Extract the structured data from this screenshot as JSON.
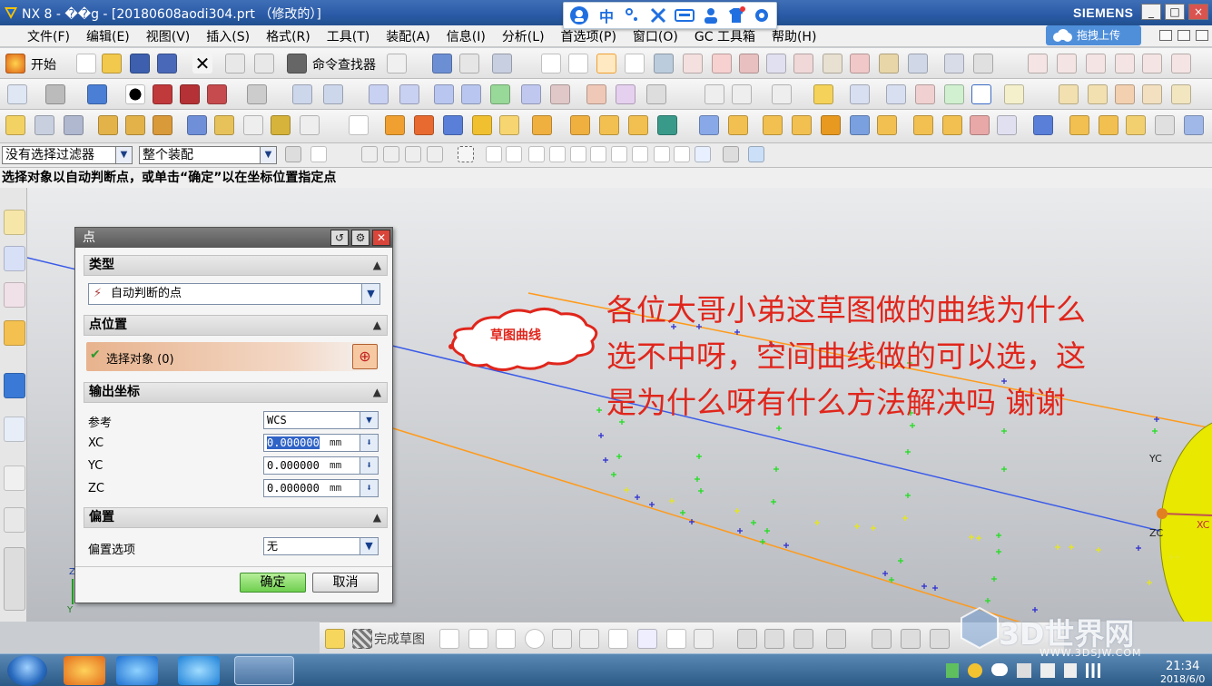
{
  "window": {
    "title": "NX 8 - ��g - [20180608aodi304.prt （修改的）]",
    "brand": "SIEMENS",
    "controls": [
      "_",
      "□",
      "×"
    ]
  },
  "ime_toolbar": {
    "icons": [
      "ime-logo-icon",
      "中",
      "°,",
      "tools-icon",
      "keyboard-icon",
      "user-icon",
      "skin-icon",
      "settings-icon"
    ],
    "chinese_label": "中"
  },
  "menu": {
    "items": [
      "文件(F)",
      "编辑(E)",
      "视图(V)",
      "插入(S)",
      "格式(R)",
      "工具(T)",
      "装配(A)",
      "信息(I)",
      "分析(L)",
      "首选项(P)",
      "窗口(O)",
      "GC 工具箱",
      "帮助(H)"
    ],
    "upload_button": "拖拽上传"
  },
  "toolbar": {
    "start_label": "开始",
    "command_finder_label": "命令查找器"
  },
  "selection_bar": {
    "filter_value": "没有选择过滤器",
    "scope_value": "整个装配"
  },
  "status": {
    "prompt": "选择对象以自动判断点，或单击“确定”以在坐标位置指定点"
  },
  "dialog": {
    "title": "点",
    "sections": {
      "type": "类型",
      "location": "点位置",
      "output": "输出坐标",
      "offset": "偏置"
    },
    "type_value": "自动判断的点",
    "select_object": "选择对象 (0)",
    "reference_label": "参考",
    "reference_value": "WCS",
    "xc_label": "XC",
    "yc_label": "YC",
    "zc_label": "ZC",
    "xc_value": "0.000000",
    "yc_value": "0.000000",
    "zc_value": "0.000000",
    "unit": "mm",
    "offset_label": "偏置选项",
    "offset_value": "无",
    "ok": "确定",
    "cancel": "取消"
  },
  "annotations": {
    "callout": "草图曲线",
    "question_line1": "各位大哥小弟这草图做的曲线为什么",
    "question_line2": "选不中呀，空间曲线做的可以选，这",
    "question_line3": "是为什么呀有什么方法解决吗  谢谢",
    "text_color": "#e0261c"
  },
  "viewport": {
    "axis_labels": {
      "yc": "YC",
      "zc": "ZC",
      "xc": "XC"
    },
    "corner_axes": {
      "z": "Z",
      "y": "Y"
    },
    "colors": {
      "orange_line": "#ff9a1a",
      "blue_line": "#3a5ae8",
      "green_points": "#22dd22",
      "yellow_points": "#e6e61e",
      "blue_points": "#3030d0",
      "sphere": "#e8e800"
    }
  },
  "bottom_toolbar": {
    "finish_sketch": "完成草图"
  },
  "watermark": {
    "title": "3D世界网",
    "url": "WWW.3DSJW.COM"
  },
  "taskbar": {
    "time": "21:34",
    "date": "2018/6/0"
  }
}
